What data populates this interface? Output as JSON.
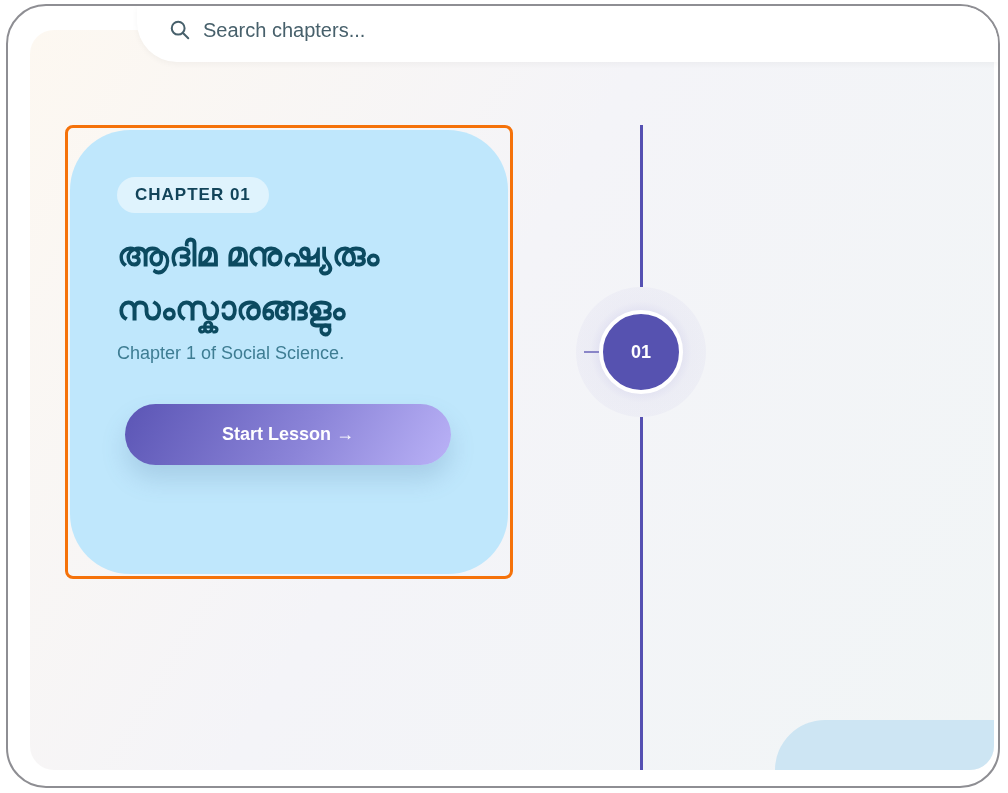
{
  "search": {
    "placeholder": "Search chapters..."
  },
  "chapters": [
    {
      "badge": "CHAPTER 01",
      "title": "ആദിമ മനുഷ്യരും സംസ്കാരങ്ങളും",
      "description": "Chapter 1 of Social Science.",
      "button": "Start Lesson →",
      "number": "01",
      "highlighted": true
    }
  ]
}
